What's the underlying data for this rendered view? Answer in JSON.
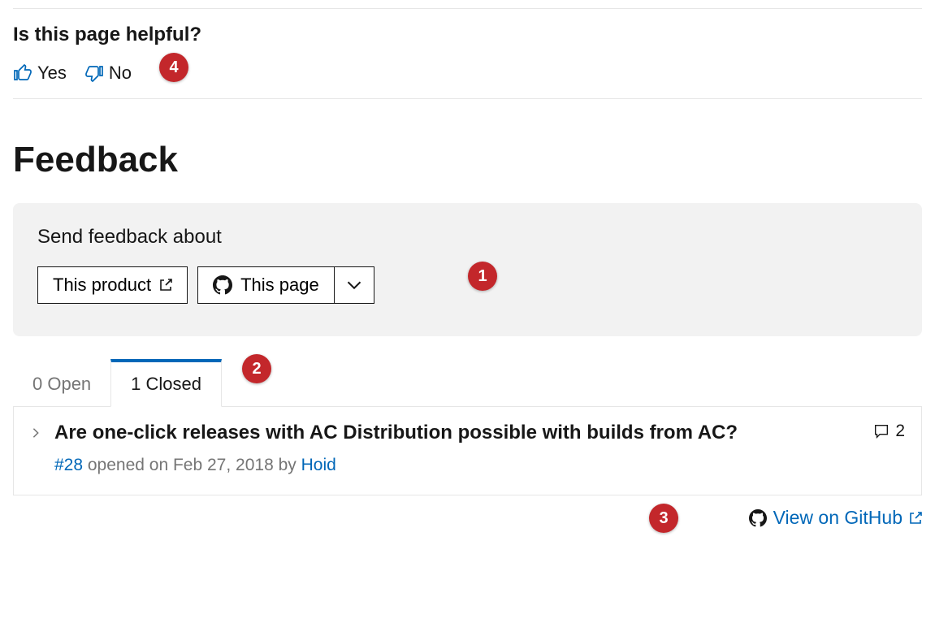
{
  "helpful": {
    "title": "Is this page helpful?",
    "yes_label": "Yes",
    "no_label": "No"
  },
  "feedback": {
    "heading": "Feedback",
    "send_label": "Send feedback about",
    "this_product_label": "This product",
    "this_page_label": "This page"
  },
  "tabs": {
    "open_label": "0 Open",
    "closed_label": "1 Closed"
  },
  "issue": {
    "title": "Are one-click releases with AC Distribution possible with builds from AC?",
    "number": "#28",
    "opened_text": " opened on Feb 27, 2018 by ",
    "author": "Hoid",
    "comments": "2"
  },
  "footer": {
    "view_on_github": "View on GitHub"
  },
  "markers": {
    "m1": "1",
    "m2": "2",
    "m3": "3",
    "m4": "4"
  }
}
